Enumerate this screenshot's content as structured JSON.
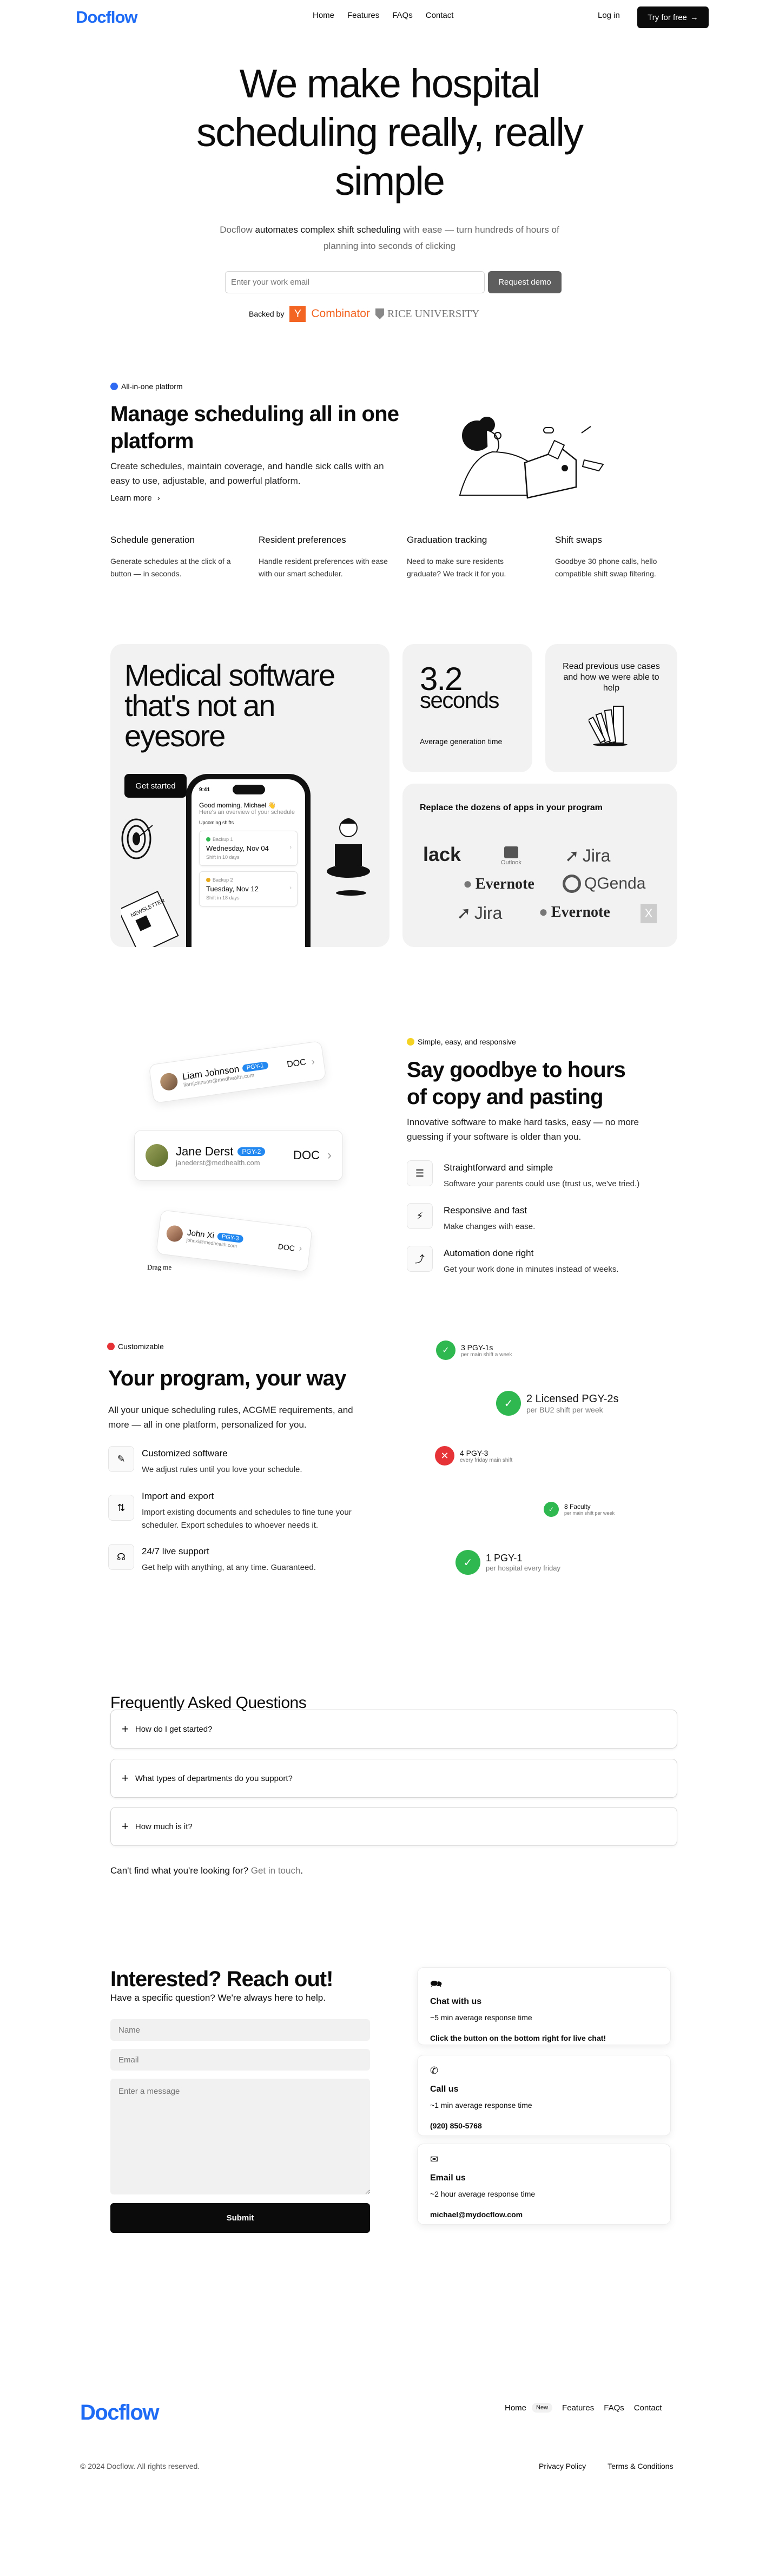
{
  "nav": {
    "logo": "Docflow",
    "links": [
      "Home",
      "Features",
      "FAQs",
      "Contact"
    ],
    "login": "Log in",
    "cta": "Try for free",
    "cta_icon": "arrow-right-icon"
  },
  "hero": {
    "title": "We make hospital scheduling really, really simple",
    "sub_prefix": "Docflow ",
    "sub_bold": "automates complex shift scheduling",
    "sub_suffix": " with ease — turn hundreds of hours of planning into seconds of clicking",
    "email_placeholder": "Enter your work email",
    "demo_button": "Request demo",
    "backed_by": "Backed by",
    "backers": [
      "Y Combinator",
      "RICE UNIVERSITY"
    ],
    "yc_letter": "Y",
    "yc_name": "Combinator",
    "rice_name": "RICE UNIVERSITY"
  },
  "platform": {
    "tag": "All-in-one platform",
    "tag_color": "#2f6bf2",
    "title": "Manage scheduling all in one platform",
    "desc": "Create schedules, maintain coverage, and handle sick calls with an easy to use, adjustable, and powerful platform.",
    "learn_more": "Learn more",
    "features": [
      {
        "title": "Schedule generation",
        "desc": "Generate schedules at the click of a button — in seconds."
      },
      {
        "title": "Resident preferences",
        "desc": "Handle resident preferences with ease with our smart scheduler."
      },
      {
        "title": "Graduation tracking",
        "desc": "Need to make sure residents graduate? We track it for you."
      },
      {
        "title": "Shift swaps",
        "desc": "Goodbye 30 phone calls, hello compatible shift swap filtering."
      }
    ]
  },
  "bento": {
    "title": "Medical software that's not an eyesore",
    "get_started": "Get started",
    "phone": {
      "time": "9:41",
      "greeting": "Good morning, Michael 👋",
      "overview": "Here's an overview of your schedule",
      "upcoming": "Upcoming shifts",
      "shifts": [
        {
          "label": "Backup 1",
          "date": "Wednesday, Nov 04",
          "sub": "Shift in 10 days",
          "color": "#2eb84f"
        },
        {
          "label": "Backup 2",
          "date": "Tuesday, Nov 12",
          "sub": "Shift in 18 days",
          "color": "#e8a91b"
        }
      ]
    },
    "newsletter": "NEWSLETTER",
    "stat_value": "3.2",
    "stat_unit": "seconds",
    "stat_label": "Average generation time",
    "use_cases": "Read previous use cases and how we were able to help",
    "apps_title": "Replace the dozens of apps in your program",
    "apps": [
      "Slack",
      "Outlook",
      "Jira",
      "Evernote",
      "QGenda",
      "Jira",
      "Evernote",
      "Excel"
    ]
  },
  "simple": {
    "tag": "Simple, easy, and responsive",
    "tag_color": "#f5d324",
    "title": "Say goodbye to hours of copy and pasting",
    "desc": "Innovative software to make hard tasks, easy — no more guessing if your software is older than you.",
    "features": [
      {
        "icon": "list-icon",
        "title": "Straightforward and simple",
        "desc": "Software your parents could use (trust us, we've tried.)"
      },
      {
        "icon": "lightning-icon",
        "title": "Responsive and fast",
        "desc": "Make changes with ease."
      },
      {
        "icon": "merge-icon",
        "title": "Automation done right",
        "desc": "Get your work done in minutes instead of weeks."
      }
    ],
    "residents": [
      {
        "name": "Liam Johnson",
        "pgy": "PGY-1",
        "email": "liamjohnson@medhealth.com",
        "role": "DOC"
      },
      {
        "name": "Jane Derst",
        "pgy": "PGY-2",
        "email": "janederst@medhealth.com",
        "role": "DOC"
      },
      {
        "name": "John Xi",
        "pgy": "PGY-3",
        "email": "johnxi@medhealth.com",
        "role": "DOC"
      }
    ],
    "drag_hint": "Drag me"
  },
  "custom": {
    "tag": "Customizable",
    "tag_color": "#e53338",
    "title": "Your program, your way",
    "desc": "All your unique scheduling rules, ACGME requirements, and more — all in one platform, personalized for you.",
    "features": [
      {
        "icon": "pencil-icon",
        "title": "Customized software",
        "desc": "We adjust rules until you love your schedule."
      },
      {
        "icon": "swap-arrows-icon",
        "title": "Import and export",
        "desc": "Import existing documents and schedules to fine tune your scheduler. Export schedules to whoever needs it."
      },
      {
        "icon": "headset-icon",
        "title": "24/7 live support",
        "desc": "Get help with anything, at any time. Guaranteed."
      }
    ],
    "requirements": [
      {
        "title": "3 PGY-1s",
        "sub": "per main shift a week",
        "ok": true
      },
      {
        "title": "2 Licensed PGY-2s",
        "sub": "per BU2 shift per week",
        "ok": true
      },
      {
        "title": "4 PGY-3",
        "sub": "every friday main shift",
        "ok": false
      },
      {
        "title": "8 Faculty",
        "sub": "per main shift per week",
        "ok": true
      },
      {
        "title": "1 PGY-1",
        "sub": "per hospital every friday",
        "ok": true
      }
    ]
  },
  "faq": {
    "title": "Frequently Asked Questions",
    "items": [
      "How do I get started?",
      "What types of departments do you support?",
      "How much is it?"
    ],
    "more_prefix": "Can't find what you're looking for? ",
    "more_link": "Get in touch",
    "more_suffix": "."
  },
  "contact": {
    "title": "Interested? Reach out!",
    "sub": "Have a specific question? We're always here to help.",
    "name_placeholder": "Name",
    "email_placeholder": "Email",
    "message_placeholder": "Enter a message",
    "submit": "Submit",
    "cards": [
      {
        "icon": "chat-icon",
        "title": "Chat with us",
        "response": "~5 min average response time",
        "value": "Click the button on the bottom right for live chat!"
      },
      {
        "icon": "phone-icon",
        "title": "Call us",
        "response": "~1 min average response time",
        "value": "(920) 850-5768"
      },
      {
        "icon": "mail-icon",
        "title": "Email us",
        "response": "~2 hour average response time",
        "value": "michael@mydocflow.com"
      }
    ]
  },
  "footer": {
    "logo": "Docflow",
    "links": [
      "Home",
      "Features",
      "FAQs",
      "Contact"
    ],
    "new_badge": "New",
    "copyright": "© 2024 Docflow. All rights reserved.",
    "legal": [
      "Privacy Policy",
      "Terms & Conditions"
    ]
  }
}
